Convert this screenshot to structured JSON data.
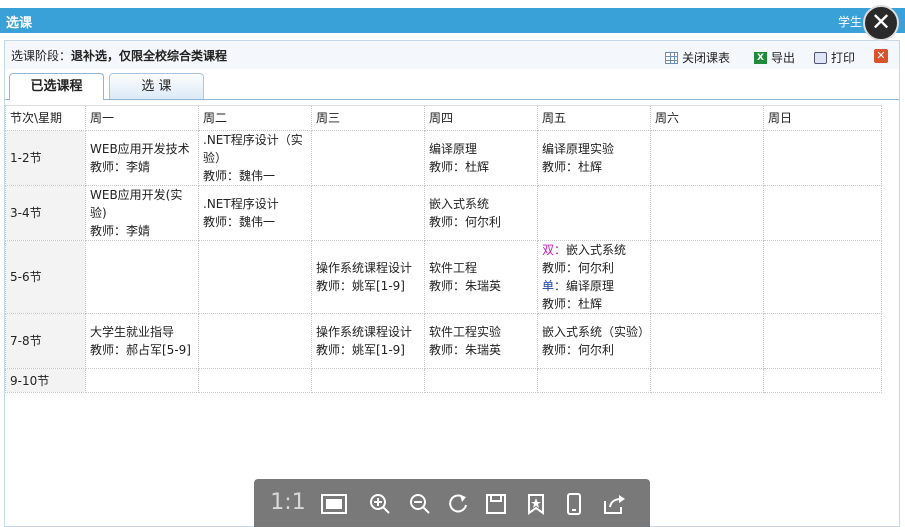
{
  "window": {
    "title": "选课",
    "user_label": "学生"
  },
  "stage": {
    "label": "选课阶段：",
    "value": "退补选，仅限全校综合类课程"
  },
  "toolbar": {
    "close_schedule": "关闭课表",
    "export": "导出",
    "print": "打印"
  },
  "tabs": [
    {
      "label": "已选课程"
    },
    {
      "label": "选    课"
    }
  ],
  "table": {
    "header": [
      "节次\\星期",
      "周一",
      "周二",
      "周三",
      "周四",
      "周五",
      "周六",
      "周日"
    ],
    "rows": [
      {
        "slot": "1-2节",
        "mon": {
          "course": "WEB应用开发技术",
          "teacher": "教师：李婧"
        },
        "tue": {
          "course": ".NET程序设计（实验）",
          "teacher": "教师：魏伟一"
        },
        "thu": {
          "course": "编译原理",
          "teacher": "教师：杜辉"
        },
        "fri": {
          "course": "编译原理实验",
          "teacher": "教师：杜辉"
        }
      },
      {
        "slot": "3-4节",
        "mon": {
          "course": "WEB应用开发(实验)",
          "teacher": "教师：李婧"
        },
        "tue": {
          "course": ".NET程序设计",
          "teacher": "教师：魏伟一"
        },
        "thu": {
          "course": "嵌入式系统",
          "teacher": "教师：何尔利"
        }
      },
      {
        "slot": "5-6节",
        "wed": {
          "course": "操作系统课程设计",
          "teacher": "教师：姚军[1-9]"
        },
        "thu": {
          "course": "软件工程",
          "teacher": "教师：朱瑞英"
        },
        "fri": {
          "even_prefix": "双：",
          "even_course": "嵌入式系统",
          "even_teacher": "教师：何尔利",
          "odd_prefix": "单：",
          "odd_course": "编译原理",
          "odd_teacher": "教师：杜辉"
        }
      },
      {
        "slot": "7-8节",
        "mon": {
          "course": "大学生就业指导",
          "teacher": "教师：郝占军[5-9]"
        },
        "wed": {
          "course": "操作系统课程设计",
          "teacher": "教师：姚军[1-9]"
        },
        "thu": {
          "course": "软件工程实验",
          "teacher": "教师：朱瑞英"
        },
        "fri": {
          "course": "嵌入式系统（实验）",
          "teacher": "教师：何尔利"
        }
      },
      {
        "slot": "9-10节"
      }
    ]
  },
  "viewer_toolbar": {
    "ratio_label": "1:1"
  },
  "colors": {
    "titlebar": "#3aa1d8",
    "even_week": "#c020c0",
    "odd_week": "#1a3fa8"
  }
}
